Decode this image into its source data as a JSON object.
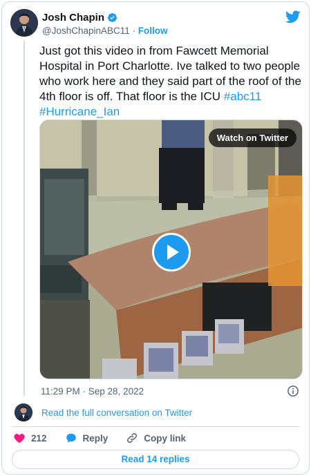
{
  "author": {
    "name": "Josh Chapin",
    "handle": "@JoshChapinABC11",
    "separator": "·",
    "follow_label": "Follow"
  },
  "tweet": {
    "text": "Just got this video in from Fawcett Memorial Hospital in Port Charlotte. Ive talked to two people who work here and they said part of the roof of the 4th floor is off. That floor is the ICU",
    "hashtags": [
      "#abc11",
      "#Hurricane_Ian"
    ]
  },
  "media": {
    "watch_label": "Watch on Twitter"
  },
  "meta": {
    "timestamp": "11:29 PM · Sep 28, 2022"
  },
  "conversation": {
    "link_label": "Read the full conversation on Twitter"
  },
  "actions": {
    "like_count": "212",
    "reply_label": "Reply",
    "copy_label": "Copy link"
  },
  "replies": {
    "button_label": "Read 14 replies"
  },
  "colors": {
    "accent": "#1d9bf0",
    "like": "#f91880",
    "muted": "#536471"
  }
}
